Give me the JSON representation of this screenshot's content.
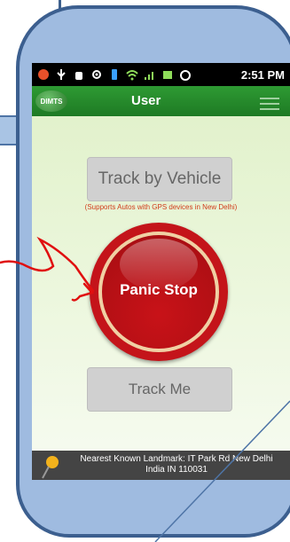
{
  "status_bar": {
    "time": "2:51 PM",
    "icons": [
      "notification-icon",
      "usb-icon",
      "android-debug-icon",
      "gps-icon",
      "vibrate-icon",
      "wifi-icon",
      "signal-icon",
      "battery-icon",
      "alarm-icon"
    ]
  },
  "header": {
    "logo_text": "DIMTS",
    "title": "User"
  },
  "main": {
    "track_vehicle_label": "Track by Vehicle",
    "track_vehicle_note": "(Supports Autos with GPS devices in New Delhi)",
    "panic_label": "Panic Stop",
    "track_me_label": "Track Me"
  },
  "landmark": {
    "line1": "Nearest Known Landmark: IT Park Rd New Delhi",
    "line2": "India IN 110031"
  },
  "colors": {
    "accent_green": "#2e9a33",
    "panic_red": "#c4141a",
    "note_red": "#d13b1a",
    "annotation_red": "#e01010"
  }
}
